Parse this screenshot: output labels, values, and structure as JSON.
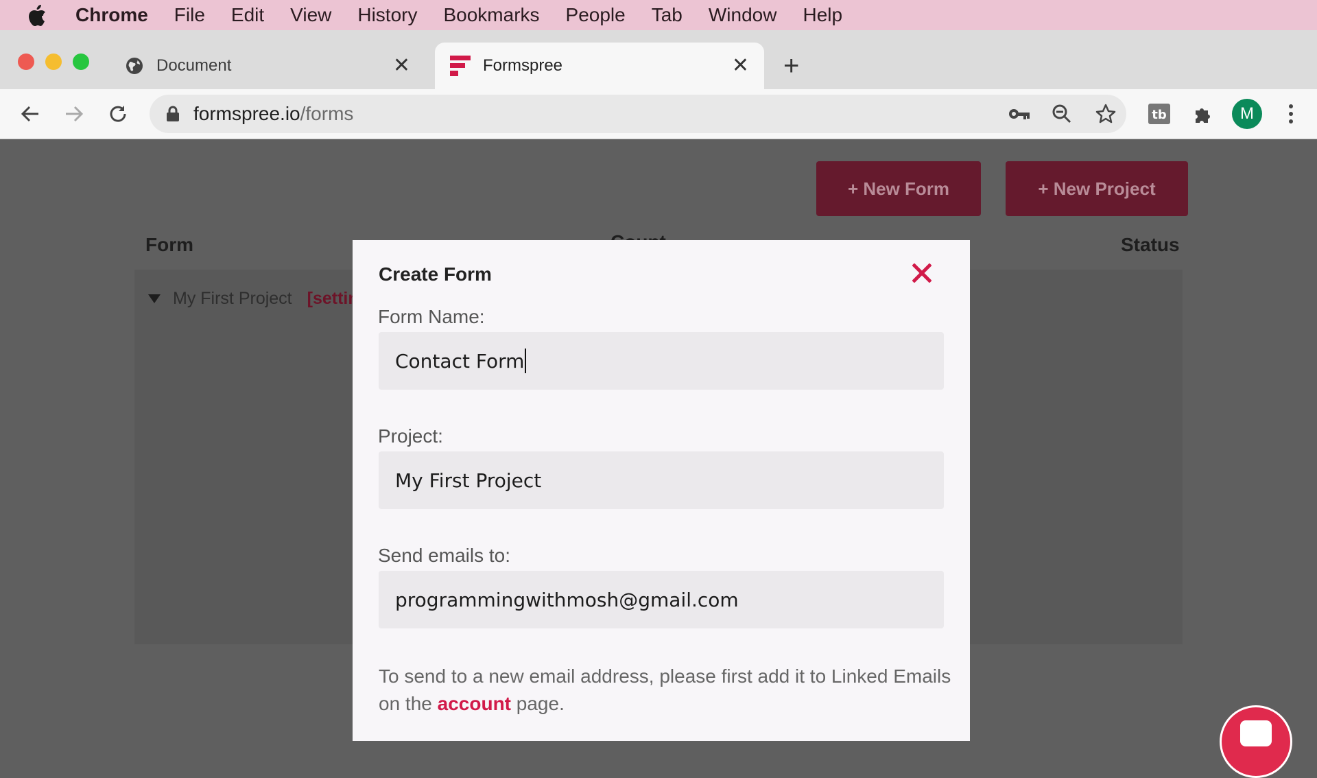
{
  "menubar": {
    "app": "Chrome",
    "items": [
      "File",
      "Edit",
      "View",
      "History",
      "Bookmarks",
      "People",
      "Tab",
      "Window",
      "Help"
    ]
  },
  "tabs": [
    {
      "title": "Document",
      "icon": "globe-icon",
      "active": false
    },
    {
      "title": "Formspree",
      "icon": "formspree-logo-icon",
      "active": true
    }
  ],
  "toolbar": {
    "url_host": "formspree.io",
    "url_path": "/forms",
    "avatar_letter": "M"
  },
  "page": {
    "new_form_label": "+ New Form",
    "new_project_label": "+ New Project",
    "col_form": "Form",
    "col_count": "Count",
    "col_status": "Status",
    "project_name": "My First Project",
    "project_settings": "[settings]"
  },
  "modal": {
    "title": "Create Form",
    "form_name_label": "Form Name:",
    "form_name_value": "Contact Form",
    "project_label": "Project:",
    "project_value": "My First Project",
    "emails_label": "Send emails to:",
    "emails_value": "programmingwithmosh@gmail.com",
    "help_prefix": "To send to a new email address, please first add it to Linked Emails on the",
    "help_link": "account",
    "help_suffix": "page."
  },
  "colors": {
    "accent": "#d11a49",
    "dark_button": "#651a2d",
    "overlay": "#5f5f5f",
    "menubar": "#ecc4d3"
  }
}
